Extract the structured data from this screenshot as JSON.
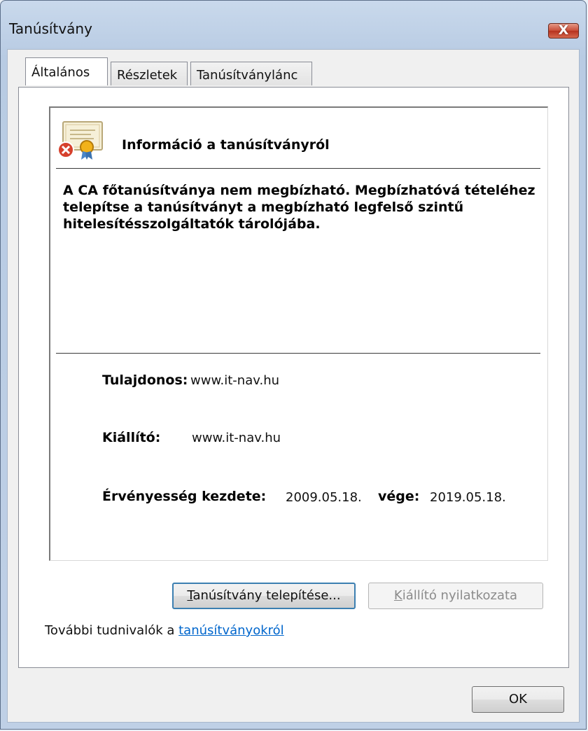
{
  "window": {
    "title": "Tanúsítvány",
    "close_glyph": "X"
  },
  "tabs": [
    {
      "label": "Általános",
      "active": true
    },
    {
      "label": "Részletek",
      "active": false
    },
    {
      "label": "Tanúsítványlánc",
      "active": false
    }
  ],
  "info": {
    "heading": "Információ a tanúsítványról",
    "warning": "A CA főtanúsítványa nem megbízható. Megbízhatóvá tételéhez telepítse a tanúsítványt a megbízható legfelső szintű hitelesítésszolgáltatók tárolójába.",
    "icon": "certificate-error-icon"
  },
  "details": {
    "owner_label": "Tulajdonos:",
    "owner_value": "www.it-nav.hu",
    "issuer_label": "Kiállító:",
    "issuer_value": "www.it-nav.hu",
    "validity_from_label": "Érvényesség kezdete:",
    "validity_from": "2009.05.18.",
    "validity_to_label": "vége:",
    "validity_to": "2019.05.18."
  },
  "buttons": {
    "install_label": "Tanúsítvány telepítése...",
    "install_accesskey": "T",
    "install_rest": "anúsítvány telepítése...",
    "issuer_statement_label": "Kiállító nyilatkozata",
    "issuer_statement_accesskey": "K",
    "issuer_statement_rest": "iállító nyilatkozata",
    "ok_label": "OK"
  },
  "footer": {
    "more_info_prefix": "További tudnivalók a ",
    "more_info_link": "tanúsítványokról"
  },
  "colors": {
    "link": "#0066cc",
    "close_button": "#c74b35",
    "default_button_border": "#3c7fb1"
  }
}
